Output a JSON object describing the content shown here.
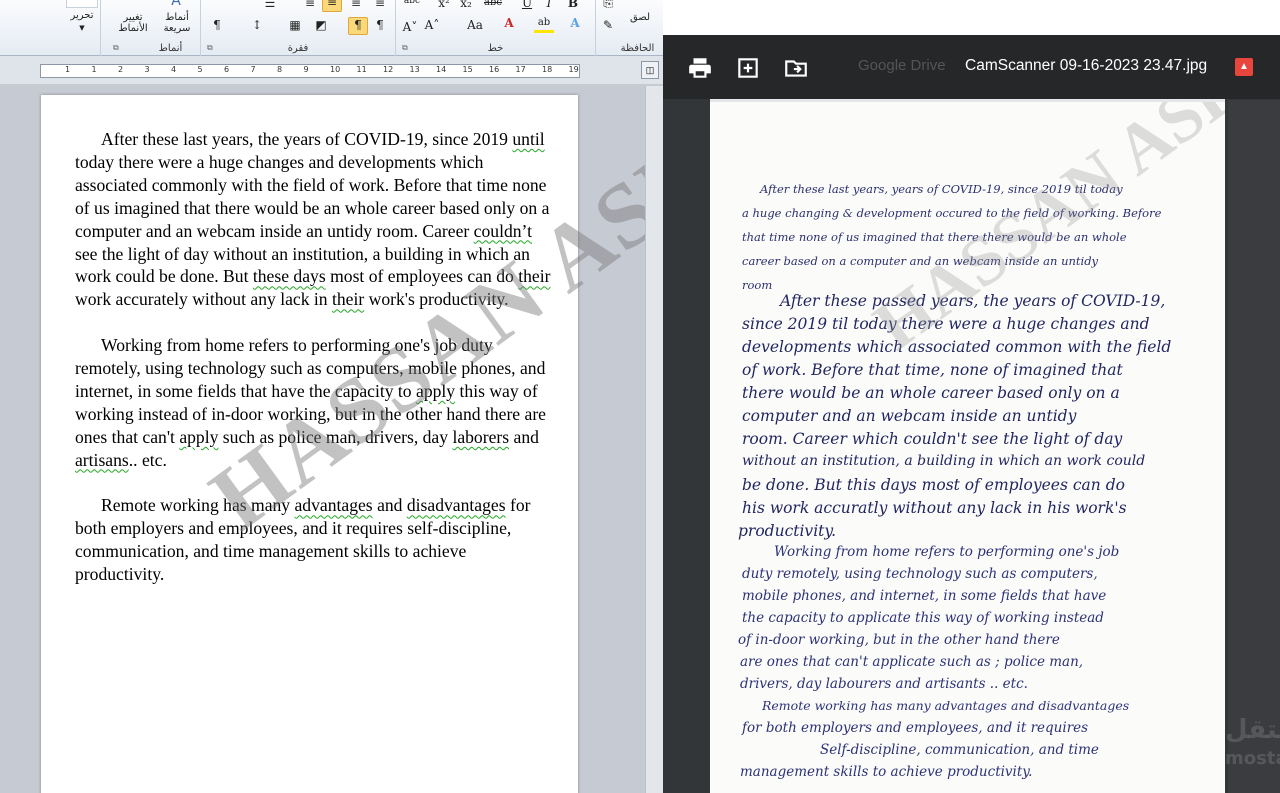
{
  "ribbon": {
    "editing": {
      "label": "تحرير"
    },
    "styles": {
      "change_styles": "تغيير الأنماط",
      "quick_styles": "أنماط سريعة",
      "group": "أنماط"
    },
    "paragraph": {
      "group": "فقرة"
    },
    "font": {
      "group": "خط"
    },
    "clipboard": {
      "paste": "لصق",
      "group": "الحافظة"
    }
  },
  "ruler": {
    "numbers": [
      "1",
      "1",
      "2",
      "3",
      "4",
      "5",
      "6",
      "7",
      "8",
      "9",
      "10",
      "11",
      "12",
      "13",
      "14",
      "15",
      "16",
      "17",
      "18",
      "19"
    ]
  },
  "document": {
    "p1": {
      "t1": "After these last years, the years of COVID-19, since 2019 ",
      "u1": "until",
      "t2": " today there were a huge changes and developments which associated commonly with the field of work. Before that time none of us imagined that there would be an whole career based only on a computer and an webcam inside an untidy room. Career ",
      "u2": "couldn’t",
      "t3": " see the light of day without an institution, a building in which an work could be done. But ",
      "u3": "these days",
      "t4": " most of employees can do ",
      "u4": "their",
      "t5": " work accurately without any lack in ",
      "u5": "their",
      "t6": " work's productivity."
    },
    "p2": {
      "t1": "Working from home refers to performing one's job duty remotely, using technology such as computers, mobile phones, and internet, in some fields that have the capacity to ",
      "u1": "apply",
      "t2": " this way of working instead of in-door working, but in the other hand there are ones that can't ",
      "u2": "apply",
      "t3": " such as police man, drivers, day ",
      "u3": "laborers",
      "t4": " and ",
      "u4": "artisans",
      "t5": ".. etc."
    },
    "p3": {
      "t1": "Remote working has many ",
      "u1": "advantages",
      "t2": " and ",
      "u2": "disadvantages",
      "t3": " for both employers and employees, and it requires self-discipline, communication, and time management skills to achieve productivity."
    },
    "watermark": "HASSAN ASHRAF"
  },
  "viewer": {
    "gdrive_label": "Google Drive",
    "filename": "CamScanner 09-16-2023 23.47.jpg",
    "print_icon": "print-icon",
    "add_icon": "add-to-drive-icon",
    "move_icon": "move-to-folder-icon",
    "image_icon": "image-file-icon",
    "site_mark": "مستقل",
    "site_mark_url": "mostaql.com"
  },
  "scan": {
    "lines": [
      "After these last years, years of COVID-19, since 2019 til today",
      "a huge changing & development occured to the field of working. Before",
      "that time none of us imagined that there there would be an whole",
      "career based on a computer and an webcam inside an untidy",
      "room",
      "After these passed years, the years of COVID-19,",
      "since 2019 til today there were a huge changes and",
      "developments which associated common with the field",
      "of work. Before that time, none of imagined that",
      "there would be an whole career based only on a",
      "computer and an webcam inside an untidy",
      "room. Career which couldn't see the light of day",
      "without an institution, a building in which an work could",
      "be done. But this days most of employees can do",
      "his work accuratly without any lack in his work's",
      "productivity.",
      "Working from home refers to performing one's job",
      "duty remotely, using technology such as computers,",
      "mobile phones, and internet, in some fields that have",
      "the capacity to applicate this way of working instead",
      "of in-door working, but in the other hand there",
      "are ones that can't applicate such as ; police man,",
      "drivers, day labourers and artisants .. etc.",
      "Remote working has many advantages and disadvantages",
      "for both employers and employees, and it requires",
      "Self-discipline, communication, and time",
      "management skills to achieve productivity."
    ],
    "watermark": "HASSAN ASHRAF"
  }
}
